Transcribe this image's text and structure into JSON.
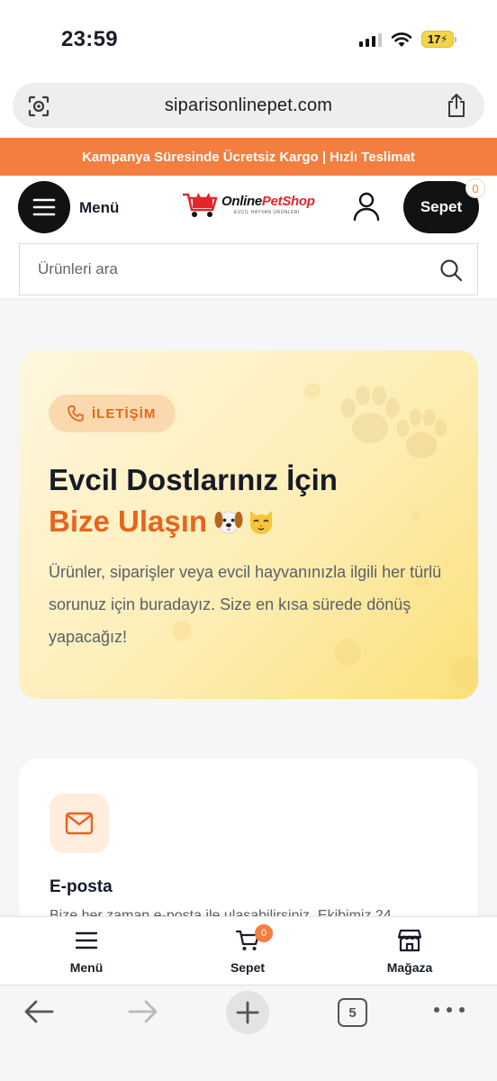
{
  "status_bar": {
    "time": "23:59",
    "battery": "17"
  },
  "browser": {
    "url": "siparisonlinepet.com",
    "open_tabs": "5"
  },
  "promo_banner": {
    "text": "Kampanya Süresinde Ücretsiz Kargo | Hızlı Teslimat"
  },
  "header": {
    "menu_label": "Menü",
    "logo": {
      "brand_plain": "Online",
      "brand_accent": "PetShop",
      "tagline": "EVCİL HAYVAN ÜRÜNLERİ"
    },
    "cart_label": "Sepet",
    "cart_count": "0",
    "search_placeholder": "Ürünleri ara"
  },
  "hero": {
    "badge": "İLETİŞİM",
    "title_line1": "Evcil Dostlarınız İçin",
    "title_line2": "Bize Ulaşın",
    "description": "Ürünler, siparişler veya evcil hayvanınızla ilgili her türlü sorunuz için buradayız. Size en kısa sürede dönüş yapacağız!"
  },
  "contact_card": {
    "title": "E-posta",
    "description": "Bize her zaman e-posta ile ulaşabilirsiniz. Ekibimiz 24"
  },
  "bottom_nav": {
    "items": [
      {
        "label": "Menü",
        "icon": "hamburger-icon"
      },
      {
        "label": "Sepet",
        "icon": "cart-icon",
        "badge": "0"
      },
      {
        "label": "Mağaza",
        "icon": "store-icon"
      }
    ]
  },
  "colors": {
    "accent": "#f47e3f",
    "accent_text": "#e8641d",
    "dark": "#111214"
  }
}
